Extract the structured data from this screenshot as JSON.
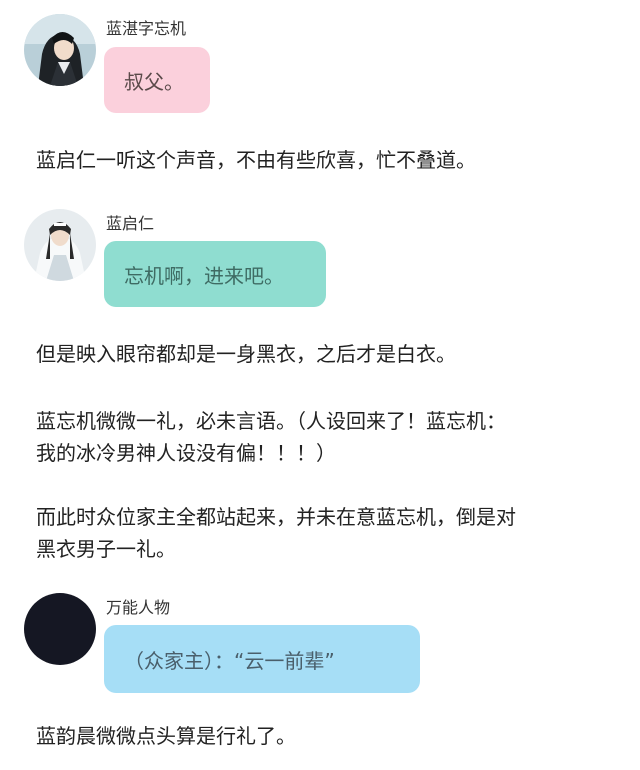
{
  "messages": [
    {
      "speaker": "蓝湛字忘机",
      "text": "叔父。",
      "avatar_icon": "character-avatar-black-robe",
      "bubble_color": "#fbd0dc"
    },
    {
      "narration": "蓝启仁一听这个声音，不由有些欣喜，忙不叠道。"
    },
    {
      "speaker": "蓝启仁",
      "text": "忘机啊，进来吧。",
      "avatar_icon": "character-avatar-white-robe",
      "bubble_color": "#8fddd0"
    },
    {
      "narration": "但是映入眼帘都却是一身黑衣，之后才是白衣。"
    },
    {
      "narration": "蓝忘机微微一礼，必未言语。（人设回来了！蓝忘机：\n我的冰冷男神人设没有偏！！！）"
    },
    {
      "narration": "而此时众位家主全都站起来，并未在意蓝忘机，倒是对\n黑衣男子一礼。"
    },
    {
      "speaker": "万能人物",
      "text": "（众家主）：“云一前辈”",
      "avatar_icon": "blank-dark-avatar",
      "bubble_color": "#a6def6"
    },
    {
      "narration": "蓝韵晨微微点头算是行礼了。"
    }
  ]
}
